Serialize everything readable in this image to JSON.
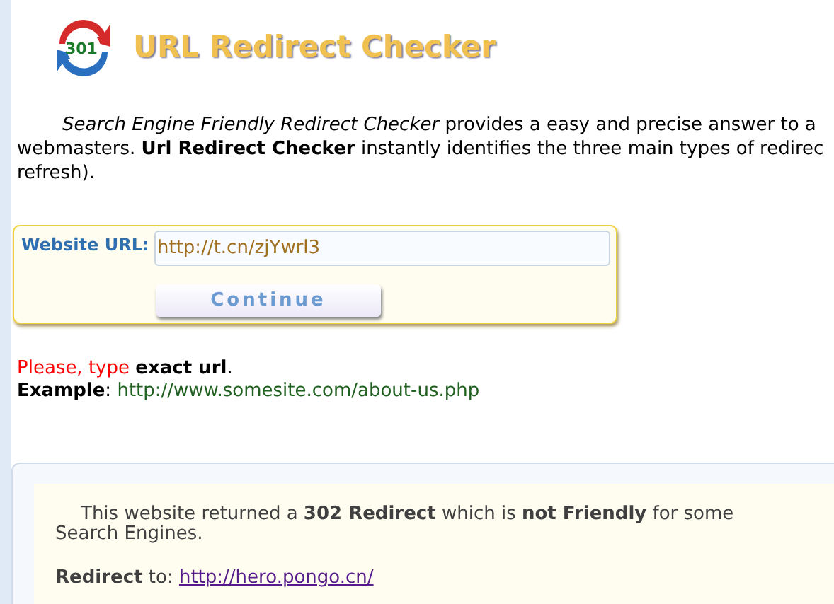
{
  "logo": {
    "badge": "301"
  },
  "title": "URL Redirect Checker",
  "intro": [
    "*Search Engine Friendly Redirect Checker* provides a easy and precise answer to a",
    "webmasters. **Url Redirect Checker** instantly identifies the three main types of redirec",
    "refresh)."
  ],
  "form": {
    "label": "Website URL:",
    "value": "http://t.cn/zjYwrl3",
    "button": "Continue"
  },
  "hint": {
    "prefix": "Please, type",
    "strong": "exact url",
    "end": ".",
    "example_label": "Example",
    "example_sep": ":",
    "example_url": "http://www.somesite.com/about-us.php"
  },
  "result": {
    "message": "This website returned a **302 Redirect** which is **not Friendly** for some Search Engines.",
    "redirect_label": "Redirect",
    "redirect_sep": "to:",
    "redirect_url": "http://hero.pongo.cn/"
  }
}
